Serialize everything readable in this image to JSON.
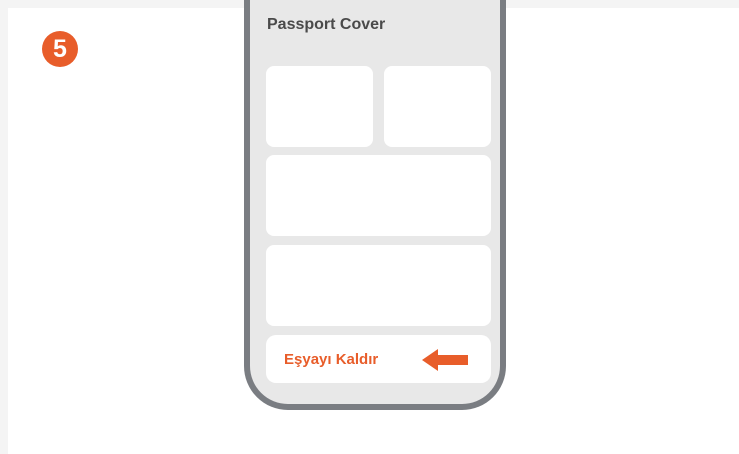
{
  "step": {
    "number": "5"
  },
  "screen": {
    "title": "Passport Cover",
    "action_label": "Eşyayı Kaldır"
  },
  "icons": {
    "pointer": "arrow-left-icon"
  },
  "colors": {
    "accent": "#e85d2a",
    "phone_frame": "#7a7d82",
    "screen_bg": "#e8e8e8",
    "card_bg": "#ffffff",
    "title_text": "#4a4a4a"
  }
}
